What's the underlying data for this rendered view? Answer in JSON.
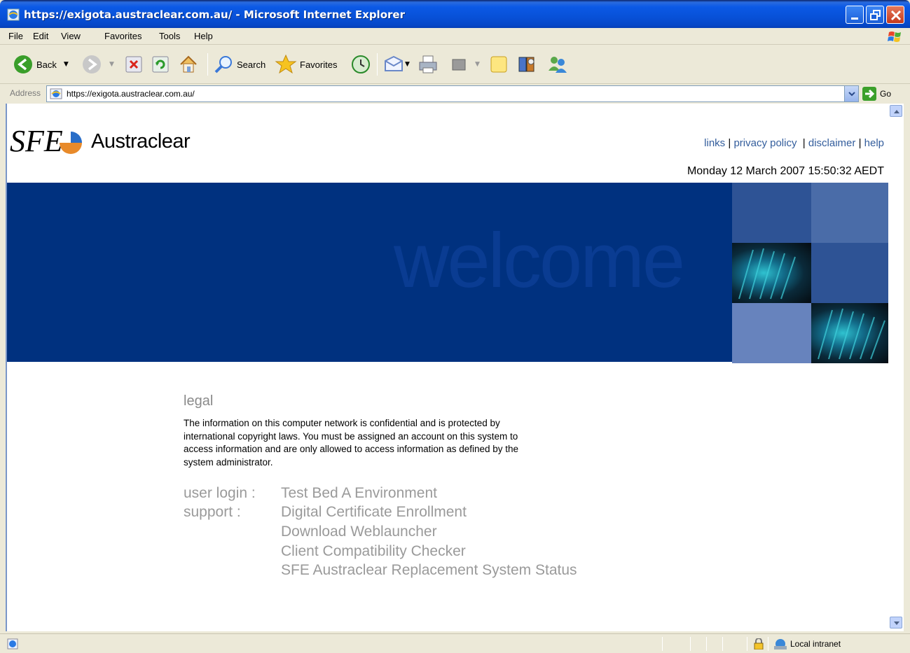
{
  "window": {
    "title": "https://exigota.austraclear.com.au/ - Microsoft Internet Explorer",
    "title_bar_color": "#0b59e6"
  },
  "menu": [
    "File",
    "Edit",
    "View",
    "Favorites",
    "Tools",
    "Help"
  ],
  "toolbar": {
    "back_label": "Back",
    "search_label": "Search",
    "favorites_label": "Favorites"
  },
  "address": {
    "label": "Address",
    "url": "https://exigota.austraclear.com.au/",
    "go_label": "Go"
  },
  "page": {
    "brand": "Austraclear",
    "links": [
      "links",
      "privacy policy",
      "disclaimer",
      "help"
    ],
    "datetime": "Monday 12 March 2007 15:50:32 AEDT",
    "banner_text": "welcome",
    "banner_color": "#00317f",
    "legal_heading": "legal",
    "legal_body": "The information on this computer network is confidential and is protected by international copyright laws. You must be assigned an account on this system to access information and are only allowed to access information as defined by the system administrator.",
    "user_login_label": "user login :",
    "user_login_link": "Test Bed A Environment",
    "support_label": "support :",
    "support_links": [
      "Digital Certificate Enrollment",
      "Download Weblauncher",
      "Client Compatibility Checker",
      "SFE Austraclear Replacement System Status"
    ]
  },
  "statusbar": {
    "zone": "Local intranet"
  },
  "icons": [
    "ie-page-icon",
    "back-arrow-icon",
    "forward-arrow-icon",
    "stop-icon",
    "refresh-icon",
    "home-icon",
    "search-icon",
    "favorites-star-icon",
    "history-icon",
    "mail-icon",
    "print-icon",
    "edit-icon",
    "discuss-icon",
    "research-icon",
    "messenger-icon",
    "go-arrow-icon",
    "lock-icon",
    "intranet-zone-icon",
    "windows-flag-icon"
  ]
}
